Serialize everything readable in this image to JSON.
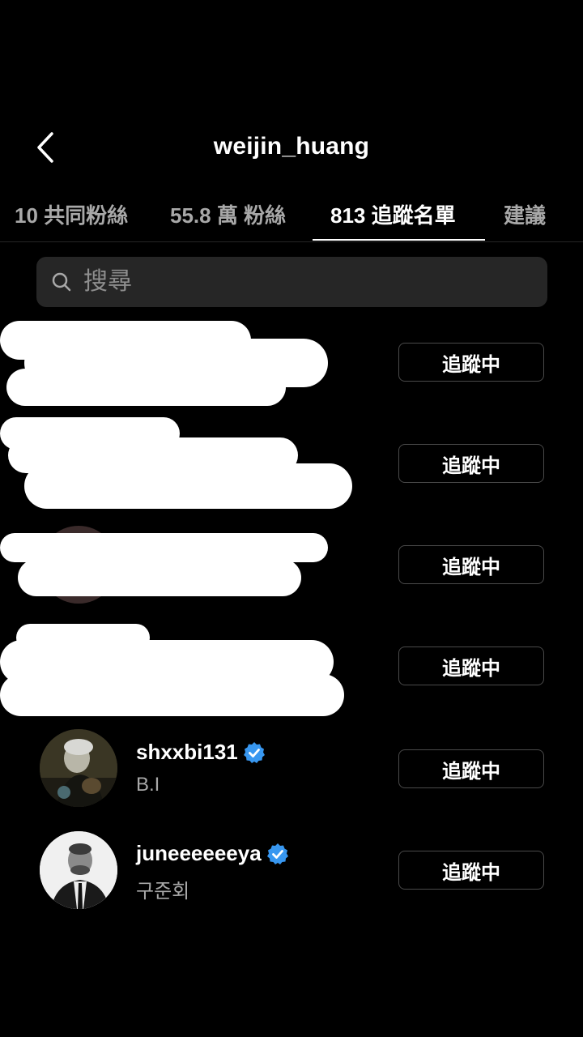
{
  "header": {
    "title": "weijin_huang",
    "back_icon": "chevron-left-icon"
  },
  "tabs": [
    {
      "label": "10 共同粉絲"
    },
    {
      "label": "55.8 萬 粉絲"
    },
    {
      "label": "813 追蹤名單"
    },
    {
      "label": "建議"
    }
  ],
  "search": {
    "placeholder": "搜尋",
    "icon": "search-icon"
  },
  "follow_label": "追蹤中",
  "users": [
    {
      "username": "",
      "subtitle": ""
    },
    {
      "username": "",
      "subtitle": ""
    },
    {
      "username": "",
      "subtitle": ""
    },
    {
      "username": "",
      "subtitle": ""
    },
    {
      "username": "shxxbi131",
      "subtitle": "B.I",
      "verified": true
    },
    {
      "username": "juneeeeeeya",
      "subtitle": "구준회",
      "verified": true
    }
  ],
  "colors": {
    "background": "#000000",
    "verified": "#3897f0",
    "secondary_text": "#a8a8a8"
  }
}
